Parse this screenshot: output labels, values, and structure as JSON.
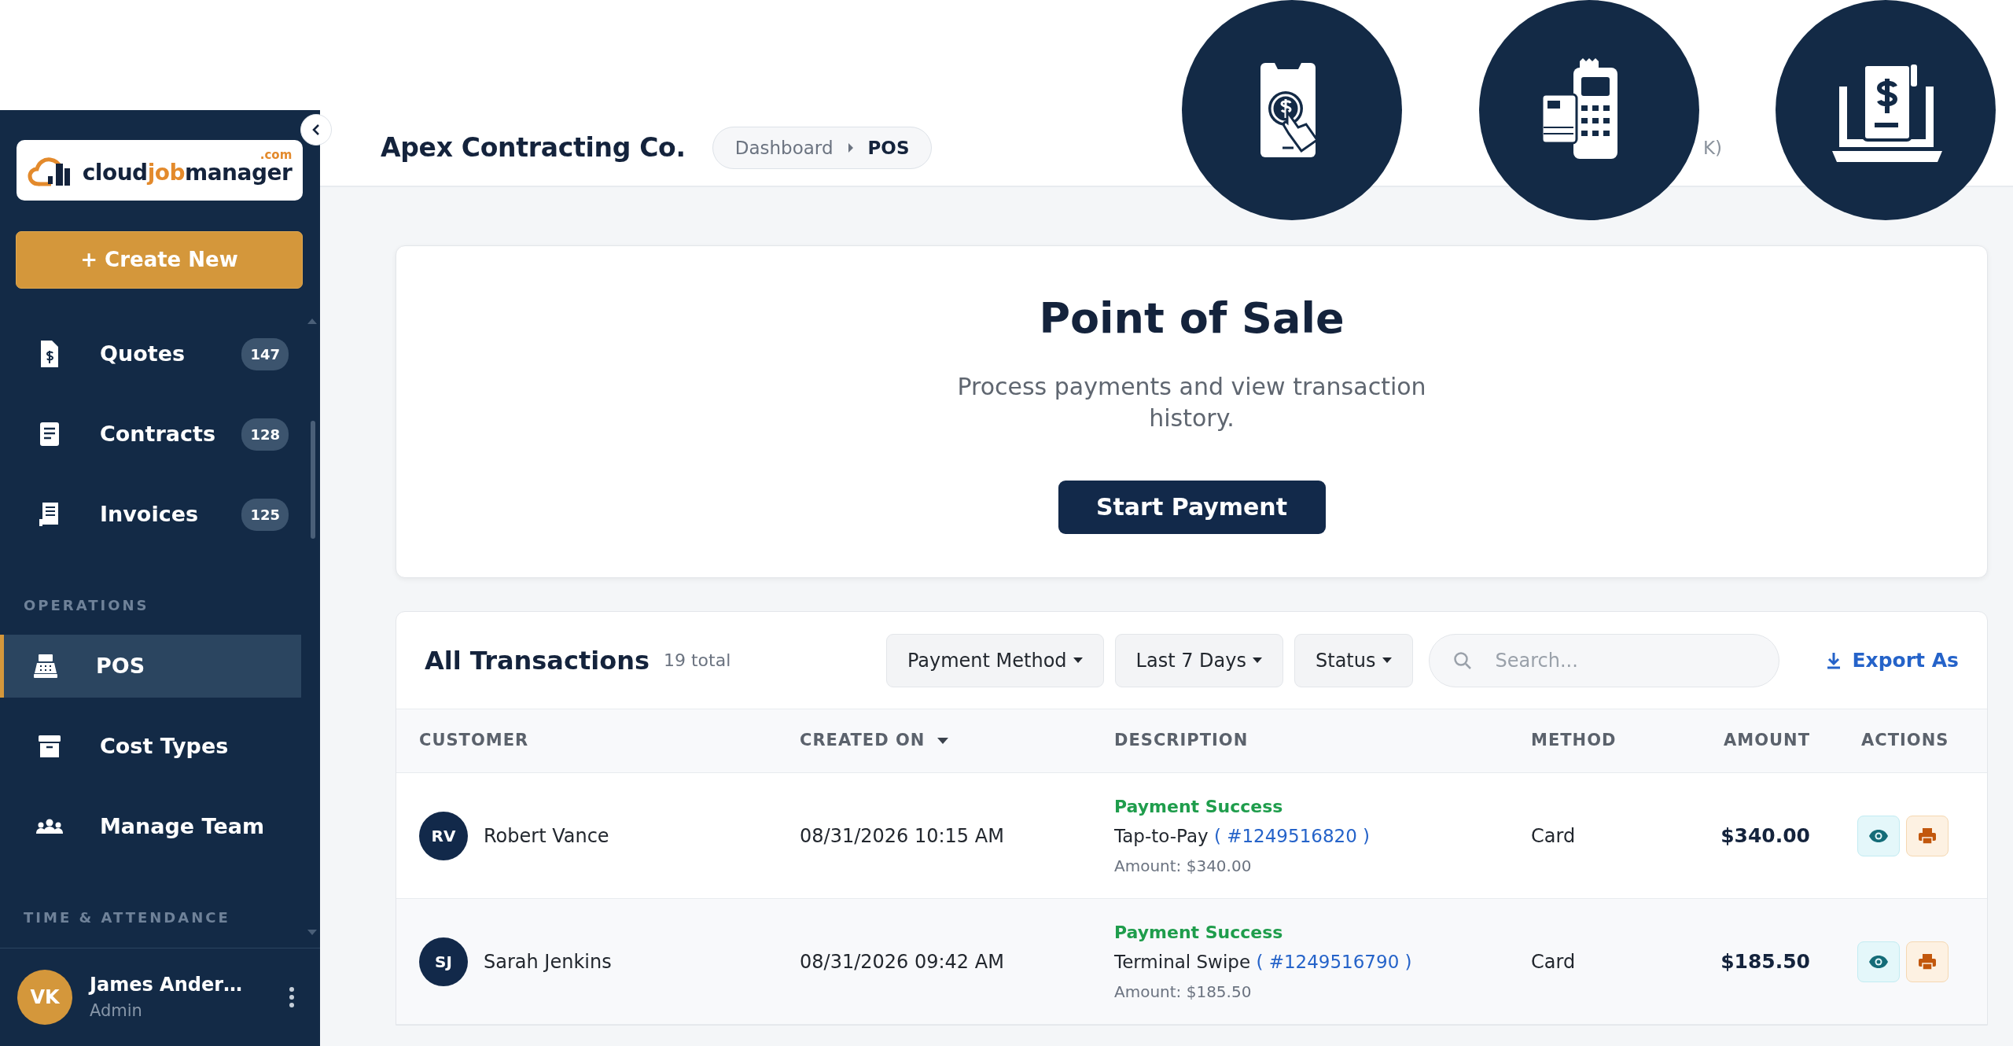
{
  "sidebar": {
    "logo": {
      "parts": [
        "cloud",
        "job",
        "manager"
      ],
      "suffix": ".com"
    },
    "create_button": "+ Create New",
    "items": [
      {
        "kind": "link",
        "label": "Quotes",
        "count": "147",
        "selected": false
      },
      {
        "kind": "link",
        "label": "Contracts",
        "count": "128",
        "selected": false
      },
      {
        "kind": "link",
        "label": "Invoices",
        "count": "125",
        "selected": false
      },
      {
        "kind": "section",
        "label": "OPERATIONS"
      },
      {
        "kind": "link",
        "label": "POS",
        "selected": true
      },
      {
        "kind": "link",
        "label": "Cost Types",
        "selected": false
      },
      {
        "kind": "link",
        "label": "Manage Team",
        "selected": false
      },
      {
        "kind": "section",
        "label": "TIME & ATTENDANCE"
      }
    ],
    "user": {
      "initials": "VK",
      "name": "James Ander…",
      "role": "Admin"
    }
  },
  "header": {
    "company": "Apex Contracting Co.",
    "breadcrumb": [
      "Dashboard",
      "POS"
    ],
    "search_text": "K)"
  },
  "hero": {
    "title": "Point of Sale",
    "subtitle": "Process payments and view transaction history.",
    "button": "Start Payment"
  },
  "transactions": {
    "title": "All Transactions",
    "total": "19 total",
    "filters": [
      "Payment Method",
      "Last 7 Days",
      "Status"
    ],
    "search": {
      "placeholder": "Search..."
    },
    "export": "Export As",
    "columns": [
      {
        "label": "CUSTOMER"
      },
      {
        "label": "CREATED ON",
        "sorted": true
      },
      {
        "label": "DESCRIPTION"
      },
      {
        "label": "METHOD"
      },
      {
        "label": "AMOUNT"
      },
      {
        "label": "ACTIONS"
      }
    ],
    "rows": [
      {
        "initials": "RV",
        "customer": "Robert Vance",
        "created_on": "08/31/2026 10:15 AM",
        "status": "Payment Success",
        "channel": "Tap-to-Pay",
        "reference": "( #1249516820 )",
        "note": "Amount: $340.00",
        "method": "Card",
        "amount": "$340.00"
      },
      {
        "initials": "SJ",
        "customer": "Sarah Jenkins",
        "created_on": "08/31/2026 09:42 AM",
        "status": "Payment Success",
        "channel": "Terminal Swipe",
        "reference": "( #1249516790 )",
        "note": "Amount: $185.50",
        "method": "Card",
        "amount": "$185.50"
      }
    ]
  }
}
